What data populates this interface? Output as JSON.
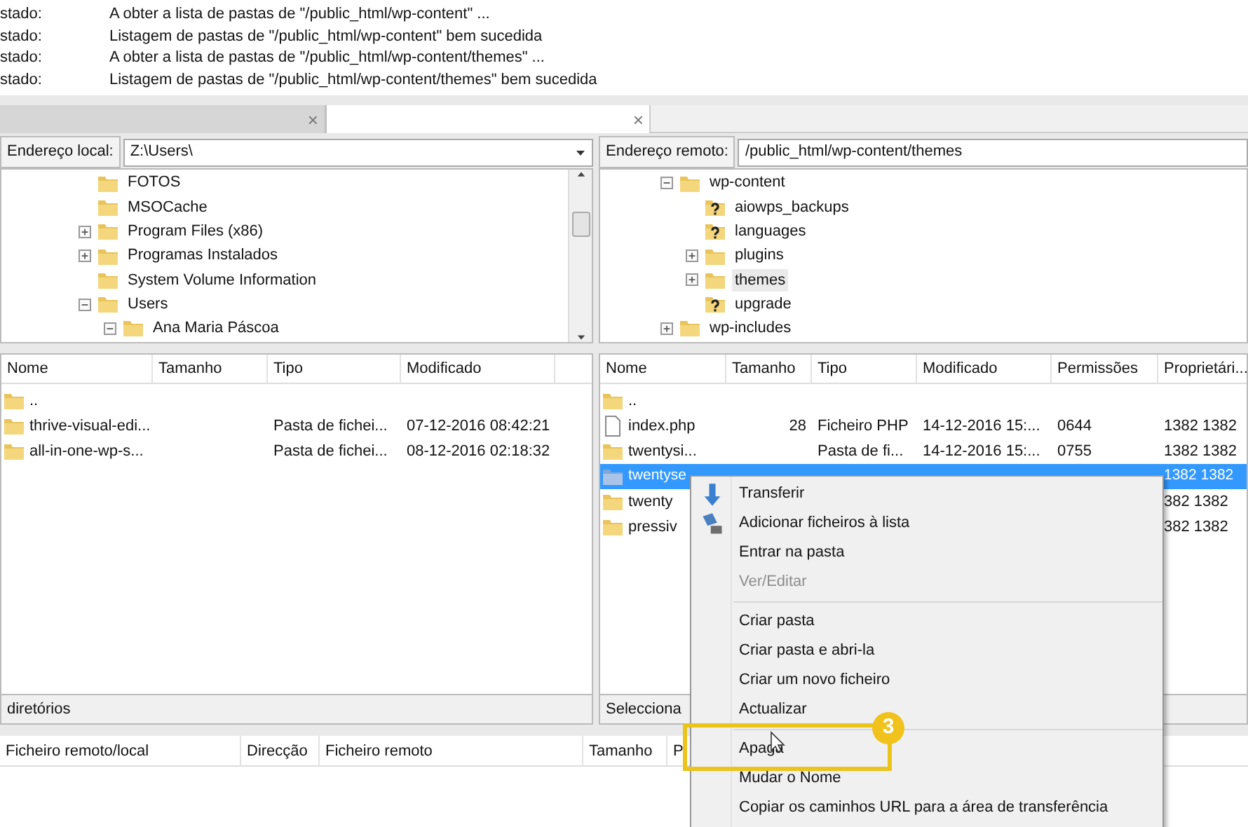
{
  "log": [
    {
      "label": "stado:",
      "message": "A obter a lista de pastas de \"/public_html/wp-content\" ..."
    },
    {
      "label": "stado:",
      "message": "Listagem de pastas de \"/public_html/wp-content\" bem sucedida"
    },
    {
      "label": "stado:",
      "message": "A obter a lista de pastas de \"/public_html/wp-content/themes\" ..."
    },
    {
      "label": "stado:",
      "message": "Listagem de pastas de \"/public_html/wp-content/themes\" bem sucedida"
    }
  ],
  "tabs": [
    {
      "close": "×",
      "selected": false
    },
    {
      "close": "×",
      "selected": true
    }
  ],
  "local": {
    "address_label": "Endereço local:",
    "address": "Z:\\Users\\",
    "tree": [
      {
        "kind": "folder",
        "name": "FOTOS"
      },
      {
        "kind": "folder",
        "name": "MSOCache"
      },
      {
        "kind": "folder",
        "name": "Program Files (x86)",
        "expanded": false
      },
      {
        "kind": "folder",
        "name": "Programas Instalados",
        "expanded": false
      },
      {
        "kind": "folder",
        "name": "System Volume Information"
      },
      {
        "kind": "folder",
        "name": "Users",
        "expanded": true,
        "children": [
          {
            "kind": "folder",
            "name": "Ana Maria Páscoa",
            "expanded": true
          }
        ]
      }
    ],
    "columns": [
      "Nome",
      "Tamanho",
      "Tipo",
      "Modificado"
    ],
    "rows": [
      {
        "kind": "folder",
        "selected": false,
        "cells": [
          ".."
        ]
      },
      {
        "kind": "folder",
        "selected": false,
        "cells": [
          "thrive-visual-edi...",
          null,
          "Pasta de fichei...",
          "07-12-2016 08:42:21"
        ]
      },
      {
        "kind": "folder",
        "selected": false,
        "cells": [
          "all-in-one-wp-s...",
          null,
          "Pasta de fichei...",
          "08-12-2016 02:18:32"
        ]
      }
    ],
    "status": "diretórios"
  },
  "remote": {
    "address_label": "Endereço remoto:",
    "address": "/public_html/wp-content/themes",
    "tree": [
      {
        "kind": "folder",
        "name": "wp-content",
        "expanded": true,
        "children": [
          {
            "kind": "unknown",
            "name": "aiowps_backups"
          },
          {
            "kind": "unknown",
            "name": "languages"
          },
          {
            "kind": "folder",
            "name": "plugins",
            "expanded": false
          },
          {
            "kind": "folder",
            "name": "themes",
            "expanded": false,
            "selected": true
          },
          {
            "kind": "unknown",
            "name": "upgrade"
          }
        ]
      },
      {
        "kind": "folder",
        "name": "wp-includes",
        "expanded": false
      }
    ],
    "columns": [
      "Nome",
      "Tamanho",
      "Tipo",
      "Modificado",
      "Permissões",
      "Proprietári..."
    ],
    "rows": [
      {
        "kind": "folder",
        "selected": false,
        "cells": [
          ".."
        ]
      },
      {
        "kind": "file",
        "selected": false,
        "cells": [
          "index.php",
          "28",
          "Ficheiro PHP",
          "14-12-2016 15:...",
          "0644",
          "1382 1382"
        ]
      },
      {
        "kind": "folder",
        "selected": false,
        "cells": [
          "twentysi...",
          null,
          "Pasta de fi...",
          "14-12-2016 15:...",
          "0755",
          "1382 1382"
        ]
      },
      {
        "kind": "folder",
        "selected": true,
        "cells": [
          "twentyse",
          null,
          null,
          null,
          null,
          "1382 1382"
        ]
      },
      {
        "kind": "folder",
        "selected": false,
        "cells": [
          "twenty",
          null,
          null,
          null,
          null,
          "382 1382"
        ]
      },
      {
        "kind": "folder",
        "selected": false,
        "cells": [
          "pressiv",
          null,
          null,
          null,
          null,
          "382 1382"
        ]
      }
    ],
    "status": "Selecciona"
  },
  "queue": {
    "columns": [
      "Ficheiro remoto/local",
      "Direcção",
      "Ficheiro remoto",
      "Tamanho",
      "P"
    ]
  },
  "context_menu": [
    {
      "kind": "iconitem",
      "label": "Transferir",
      "disabled": false
    },
    {
      "kind": "iconitem",
      "label": "Adicionar ficheiros à lista",
      "disabled": false
    },
    {
      "kind": "item",
      "label": "Entrar na pasta",
      "disabled": false
    },
    {
      "kind": "item",
      "label": "Ver/Editar",
      "disabled": true
    },
    {
      "kind": "separator"
    },
    {
      "kind": "item",
      "label": "Criar pasta",
      "disabled": false
    },
    {
      "kind": "item",
      "label": "Criar pasta e abri-la",
      "disabled": false
    },
    {
      "kind": "item",
      "label": "Criar um novo ficheiro",
      "disabled": false
    },
    {
      "kind": "item",
      "label": "Actualizar",
      "disabled": false
    },
    {
      "kind": "separator"
    },
    {
      "kind": "item",
      "label": "Apaga",
      "disabled": false,
      "highlighted": true
    },
    {
      "kind": "item",
      "label": "Mudar o Nome",
      "disabled": false
    },
    {
      "kind": "item",
      "label": "Copiar os caminhos URL para a área de transferência",
      "disabled": false
    }
  ],
  "annotation": {
    "number": "3"
  }
}
